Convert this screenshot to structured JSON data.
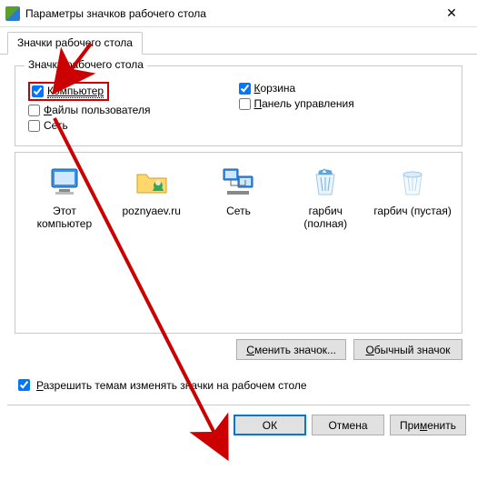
{
  "window": {
    "title": "Параметры значков рабочего стола",
    "close": "✕"
  },
  "tab": {
    "label": "Значки рабочего стола"
  },
  "group": {
    "legend": "Значки рабочего стола",
    "computer": "Компьютер",
    "recycle": "Корзина",
    "userfiles": "Файлы пользователя",
    "controlpanel": "Панель управления",
    "network": "Сеть"
  },
  "icons": {
    "thispc": "Этот компьютер",
    "user": "poznyaev.ru",
    "net": "Сеть",
    "binfull": "гарбич (полная)",
    "binempty": "гарбич (пустая)"
  },
  "iconBtns": {
    "change": "Сменить значок...",
    "default": "Обычный значок"
  },
  "allowThemes": "Разрешить темам изменять значки на рабочем столе",
  "dlg": {
    "ok": "ОК",
    "cancel": "Отмена",
    "apply": "Применить"
  },
  "checked": {
    "computer": true,
    "recycle": true,
    "userfiles": false,
    "controlpanel": false,
    "network": false,
    "allowThemes": true
  }
}
